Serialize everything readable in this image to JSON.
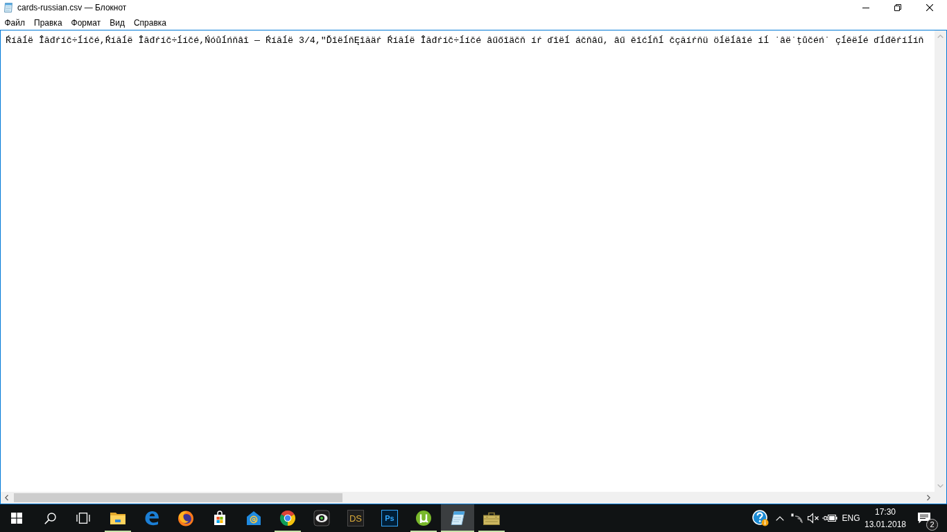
{
  "window": {
    "title": "cards-russian.csv — Блокнот"
  },
  "menu": [
    "Файл",
    "Правка",
    "Формат",
    "Вид",
    "Справка"
  ],
  "editor": {
    "text": "Ŕíăĺë Îăđŕíč÷ĺíčé,Ŕíăĺë Îăđŕíč÷ĺíčé,Ńóůĺńňâî — Ŕíăĺë 3/4,\"ĎîëĺňĘîăäŕ Ŕíăĺë Îăđŕíč÷ĺíčé âűőîäčň íŕ ďîëĺ áčňâű, âű ěîćĺňĺ čçăíŕňü öĺëĺâîé íĺ ˙âë˙ţůčéń˙ çĺěëĺé ďĺđěŕíĺíň"
  },
  "taskbar": {
    "apps": [
      {
        "kind": "folder",
        "running": true,
        "selected": false
      },
      {
        "kind": "browser-e",
        "running": false,
        "selected": false
      },
      {
        "kind": "browser-fox",
        "running": false,
        "selected": false
      },
      {
        "kind": "store",
        "running": false,
        "selected": false
      },
      {
        "kind": "mail",
        "running": false,
        "selected": false
      },
      {
        "kind": "browser-ring",
        "running": true,
        "selected": false
      },
      {
        "kind": "camera",
        "running": false,
        "selected": false
      },
      {
        "kind": "tile-gold",
        "label": "DS",
        "running": false,
        "selected": false
      },
      {
        "kind": "tile-blue",
        "label": "Ps",
        "running": false,
        "selected": false
      },
      {
        "kind": "torrent",
        "running": true,
        "selected": false
      },
      {
        "kind": "notepad",
        "running": true,
        "selected": true
      },
      {
        "kind": "toolbox",
        "running": true,
        "selected": false
      }
    ],
    "tray": {
      "language": "ENG",
      "time": "17:30",
      "date": "13.01.2018",
      "notifications": "2"
    }
  }
}
